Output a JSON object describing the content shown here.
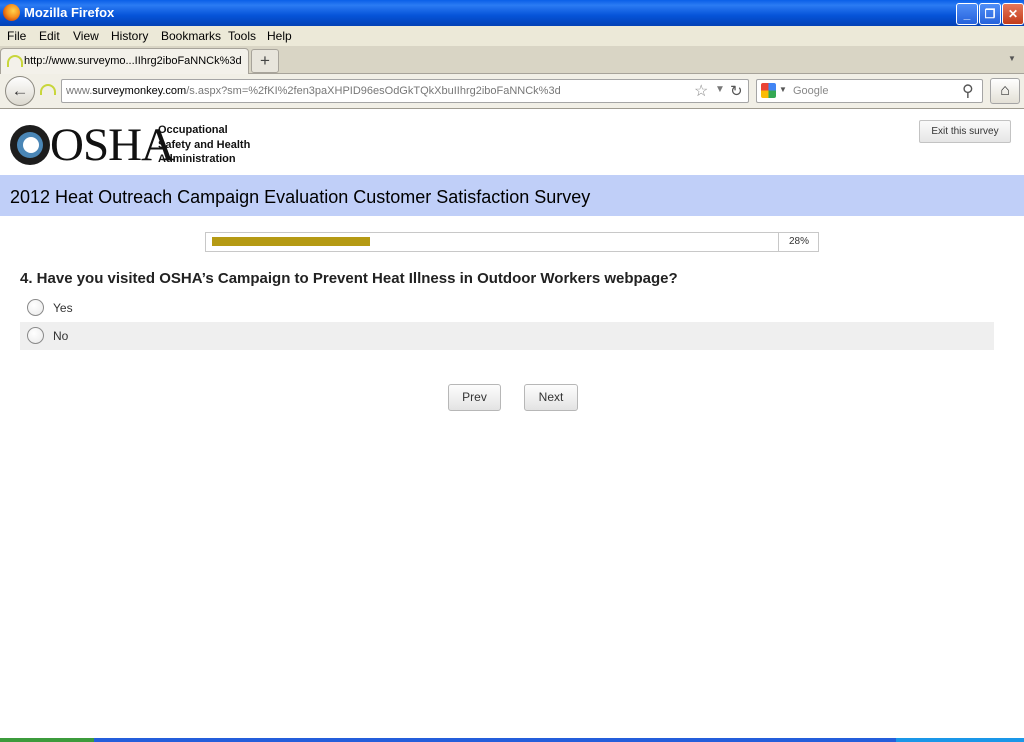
{
  "window": {
    "title": "Mozilla Firefox",
    "controls": [
      "minimize-icon",
      "restore-icon",
      "close-icon"
    ]
  },
  "menubar": {
    "items": [
      {
        "label": "File",
        "mnemonic": "F"
      },
      {
        "label": "Edit",
        "mnemonic": "E"
      },
      {
        "label": "View",
        "mnemonic": "V"
      },
      {
        "label": "History",
        "mnemonic": "s"
      },
      {
        "label": "Bookmarks",
        "mnemonic": "B"
      },
      {
        "label": "Tools",
        "mnemonic": "T"
      },
      {
        "label": "Help",
        "mnemonic": "H"
      }
    ]
  },
  "tabs": [
    {
      "title": "http://www.surveymo...IIhrg2iboFaNNCk%3d",
      "icon": "loading-icon"
    }
  ],
  "newtab": {
    "label": "+"
  },
  "navbar": {
    "url_prefix": "www.",
    "url_host": "surveymonkey.com",
    "url_path": "/s.aspx?sm=%2fKI%2fen3paXHPID96esOdGkTQkXbuIIhrg2iboFaNNCk%3d",
    "search_placeholder": "Google",
    "search_engine_icon": "google-icon"
  },
  "page": {
    "logo_text": "OSHA",
    "agency_lines": [
      "Occupational",
      "Safety and Health",
      "Administration"
    ],
    "exit_button": "Exit this survey",
    "survey_title": "2012 Heat Outreach Campaign Evaluation Customer Satisfaction Survey",
    "progress": {
      "percent": 28,
      "label": "28%",
      "fill_color": "#b59a14"
    },
    "question": "4. Have you visited OSHA’s Campaign to Prevent Heat Illness in Outdoor Workers webpage?",
    "options": [
      "Yes",
      "No"
    ],
    "buttons": {
      "prev": "Prev",
      "next": "Next"
    },
    "banner_color": "#c0cff8"
  }
}
